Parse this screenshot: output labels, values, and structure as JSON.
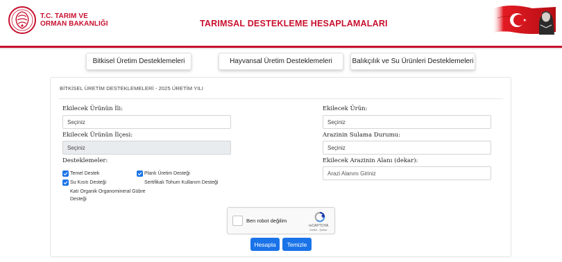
{
  "header": {
    "ministry_line1": "T.C. TARIM VE",
    "ministry_line2": "ORMAN BAKANLIĞI",
    "app_title": "TARIMSAL DESTEKLEME HESAPLAMALARI",
    "brand_color": "#c8102e"
  },
  "tabs": [
    {
      "label": "Bitkisel Üretim Desteklemeleri"
    },
    {
      "label": "Hayvansal Üretim Desteklemeleri"
    },
    {
      "label": "Balıkçılık ve Su Ürünleri Desteklemeleri"
    }
  ],
  "panel": {
    "title": "BİTKİSEL ÜRETİM DESTEKLEMELERİ - 2025 ÜRETİM YILI"
  },
  "form": {
    "il_label": "Ekilecek Ürünün İli:",
    "il_value": "Seçiniz",
    "ilce_label": "Ekilecek Ürünün İlçesi:",
    "ilce_value": "Seçiniz",
    "urun_label": "Ekilecek Ürün:",
    "urun_value": "Seçiniz",
    "sulama_label": "Arazinin Sulama Durumu:",
    "sulama_value": "Seçiniz",
    "alan_label": "Ekilecek Arazinin Alanı (dekar):",
    "alan_placeholder": "Arazi Alanını Giriniz",
    "destek_label": "Desteklemeler:"
  },
  "supports": {
    "temel": {
      "label": "Temel Destek",
      "checked": true
    },
    "planli": {
      "label": "Planlı Üretim Desteği",
      "checked": true
    },
    "su": {
      "label": "Su Kısıtı Desteği",
      "checked": true
    },
    "sertifikali": {
      "label": "Sertifikalı Tohum Kullanım Desteği",
      "checked": false
    },
    "kati_line1": "Katı Organik Organomineral Gübre",
    "kati_line2": "Desteği",
    "kati_checked": false
  },
  "captcha": {
    "label": "Ben robot değilim",
    "brand": "reCAPTCHA",
    "links": "Gizlilik - Şartlar"
  },
  "buttons": {
    "calculate": "Hesapla",
    "clear": "Temizle"
  },
  "colors": {
    "accent": "#1a73e8",
    "brand_red": "#c8102e"
  }
}
